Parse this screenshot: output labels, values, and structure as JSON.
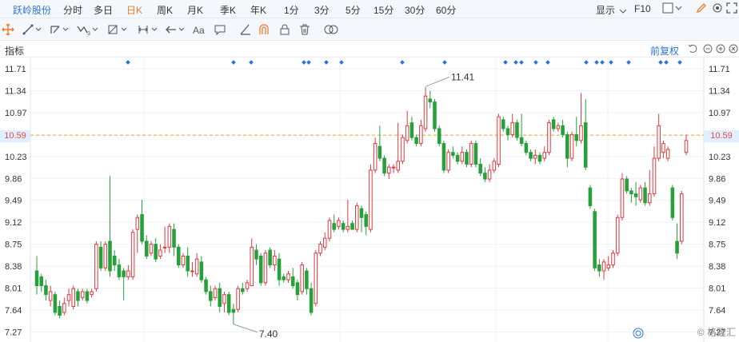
{
  "toolbar": {
    "stock_name": "跃岭股份",
    "periods": [
      "分时",
      "多日",
      "日K",
      "周K",
      "月K",
      "季K",
      "年K",
      "1分",
      "3分",
      "5分",
      "15分",
      "30分",
      "60分"
    ],
    "active_period": "日K",
    "display_label": "显示",
    "f10_label": "F10"
  },
  "drawing_tools": [
    "move-icon",
    "line-icon",
    "channel-icon",
    "wave-icon",
    "measure-icon",
    "range-icon",
    "arrow-icon",
    "text-icon",
    "comment-icon",
    "pen-icon",
    "magnet-icon",
    "lock-icon",
    "trash-icon",
    "eye-icon"
  ],
  "indicator_bar": {
    "label": "指标",
    "restore_label": "前复权"
  },
  "price_axis": {
    "ticks": [
      "11.71",
      "11.34",
      "10.97",
      "10.59",
      "10.23",
      "9.86",
      "9.49",
      "9.12",
      "8.75",
      "8.38",
      "8.01",
      "7.64",
      "7.27"
    ],
    "current_price": "10.59",
    "current_price_right": "10.59"
  },
  "annotations": {
    "high": "11.41",
    "low": "7.40"
  },
  "watermark": "格隆汇",
  "colors": {
    "up": "#e0393e",
    "down": "#26a03a",
    "accent": "#2e73d6",
    "active": "#f0792b",
    "price_line": "#f0a030"
  },
  "chart_data": {
    "type": "candlestick",
    "ylim": [
      7.1,
      11.9
    ],
    "y_ticks": [
      11.71,
      11.34,
      10.97,
      10.59,
      10.23,
      9.86,
      9.49,
      9.12,
      8.75,
      8.38,
      8.01,
      7.64,
      7.27
    ],
    "reference_price": 10.59,
    "high_marker": 11.41,
    "low_marker": 7.4,
    "candles": [
      [
        8.3,
        8.05,
        8.55,
        7.9
      ],
      [
        8.2,
        8.05,
        8.25,
        7.95
      ],
      [
        8.05,
        7.9,
        8.15,
        7.8
      ],
      [
        7.8,
        7.95,
        8.05,
        7.7
      ],
      [
        7.9,
        7.6,
        7.95,
        7.55
      ],
      [
        7.7,
        7.55,
        7.8,
        7.5
      ],
      [
        7.6,
        7.75,
        7.85,
        7.55
      ],
      [
        7.8,
        7.9,
        8.0,
        7.7
      ],
      [
        7.7,
        8.0,
        8.05,
        7.65
      ],
      [
        7.95,
        7.8,
        8.0,
        7.7
      ],
      [
        7.85,
        7.95,
        8.0,
        7.8
      ],
      [
        7.95,
        7.8,
        8.0,
        7.75
      ],
      [
        7.9,
        7.95,
        8.0,
        7.85
      ],
      [
        8.0,
        8.75,
        8.8,
        7.95
      ],
      [
        8.7,
        8.35,
        8.8,
        8.3
      ],
      [
        8.35,
        8.75,
        8.8,
        8.3
      ],
      [
        8.8,
        8.3,
        9.9,
        8.2
      ],
      [
        8.55,
        8.4,
        8.65,
        8.3
      ],
      [
        8.4,
        8.2,
        8.5,
        8.15
      ],
      [
        8.3,
        8.2,
        8.35,
        7.8
      ],
      [
        8.2,
        8.3,
        8.4,
        8.15
      ],
      [
        8.2,
        8.95,
        9.0,
        8.15
      ],
      [
        9.0,
        9.2,
        9.25,
        8.6
      ],
      [
        9.25,
        8.8,
        9.5,
        8.75
      ],
      [
        8.8,
        8.55,
        8.9,
        8.5
      ],
      [
        8.6,
        8.75,
        8.8,
        8.55
      ],
      [
        8.75,
        8.5,
        8.85,
        8.45
      ],
      [
        8.55,
        8.65,
        8.75,
        8.5
      ],
      [
        8.7,
        8.7,
        9.05,
        8.6
      ],
      [
        8.7,
        9.05,
        9.1,
        8.6
      ],
      [
        9.0,
        8.7,
        9.1,
        8.55
      ],
      [
        8.7,
        8.4,
        8.75,
        8.35
      ],
      [
        8.4,
        8.55,
        8.6,
        8.35
      ],
      [
        8.55,
        8.3,
        8.7,
        8.2
      ],
      [
        8.3,
        8.3,
        8.45,
        8.2
      ],
      [
        8.25,
        8.5,
        8.6,
        8.2
      ],
      [
        8.45,
        8.15,
        8.55,
        8.1
      ],
      [
        8.15,
        7.95,
        8.2,
        7.9
      ],
      [
        7.95,
        7.8,
        8.05,
        7.7
      ],
      [
        7.85,
        8.0,
        8.05,
        7.8
      ],
      [
        8.0,
        7.7,
        8.1,
        7.6
      ],
      [
        7.75,
        7.9,
        7.95,
        7.6
      ],
      [
        7.9,
        7.6,
        7.95,
        7.55
      ],
      [
        7.65,
        7.6,
        7.75,
        7.4
      ],
      [
        7.65,
        8.0,
        8.05,
        7.6
      ],
      [
        8.0,
        7.95,
        8.1,
        7.9
      ],
      [
        8.0,
        8.1,
        8.15,
        7.95
      ],
      [
        8.05,
        8.7,
        8.85,
        8.05
      ],
      [
        8.65,
        8.5,
        8.75,
        8.4
      ],
      [
        8.55,
        8.1,
        8.6,
        8.05
      ],
      [
        8.1,
        8.6,
        8.65,
        8.05
      ],
      [
        8.65,
        8.4,
        8.7,
        8.35
      ],
      [
        8.4,
        8.55,
        8.65,
        8.3
      ],
      [
        8.5,
        8.15,
        8.6,
        8.05
      ],
      [
        8.2,
        8.15,
        8.25,
        8.1
      ],
      [
        8.15,
        8.25,
        8.3,
        8.1
      ],
      [
        8.2,
        8.05,
        8.35,
        8.0
      ],
      [
        8.1,
        7.9,
        8.15,
        7.8
      ],
      [
        7.95,
        8.4,
        8.45,
        7.9
      ],
      [
        8.3,
        8.0,
        8.35,
        7.9
      ],
      [
        8.0,
        7.6,
        8.1,
        7.55
      ],
      [
        7.75,
        8.6,
        8.65,
        7.7
      ],
      [
        8.6,
        8.75,
        8.8,
        8.55
      ],
      [
        8.7,
        8.85,
        8.95,
        8.65
      ],
      [
        8.85,
        9.15,
        9.2,
        8.8
      ],
      [
        9.1,
        9.0,
        9.25,
        8.95
      ],
      [
        9.05,
        9.15,
        9.2,
        9.0
      ],
      [
        9.1,
        9.0,
        9.15,
        8.95
      ],
      [
        9.0,
        9.05,
        9.5,
        8.95
      ],
      [
        9.1,
        9.0,
        9.15,
        9.0
      ],
      [
        9.0,
        9.4,
        9.45,
        8.95
      ],
      [
        9.35,
        9.2,
        9.4,
        8.95
      ],
      [
        9.25,
        9.05,
        9.3,
        8.9
      ],
      [
        9.0,
        10.0,
        10.1,
        8.95
      ],
      [
        10.0,
        10.45,
        10.55,
        9.95
      ],
      [
        10.4,
        10.2,
        10.75,
        10.15
      ],
      [
        10.2,
        9.95,
        10.25,
        9.9
      ],
      [
        9.95,
        10.05,
        10.1,
        9.85
      ],
      [
        10.05,
        10.05,
        10.1,
        9.95
      ],
      [
        10.0,
        10.15,
        10.8,
        9.95
      ],
      [
        10.15,
        10.55,
        10.6,
        10.1
      ],
      [
        10.5,
        10.75,
        11.0,
        10.45
      ],
      [
        10.8,
        10.55,
        10.9,
        10.5
      ],
      [
        10.55,
        10.45,
        10.6,
        10.4
      ],
      [
        10.45,
        10.75,
        10.85,
        10.4
      ],
      [
        10.7,
        11.25,
        11.4,
        10.65
      ],
      [
        11.2,
        11.15,
        11.34,
        11.05
      ],
      [
        11.15,
        10.7,
        11.2,
        10.65
      ],
      [
        10.7,
        10.45,
        10.75,
        10.4
      ],
      [
        10.45,
        10.0,
        10.5,
        9.95
      ],
      [
        10.0,
        10.3,
        10.35,
        9.95
      ],
      [
        10.3,
        10.25,
        10.4,
        10.2
      ],
      [
        10.25,
        10.15,
        10.3,
        10.1
      ],
      [
        10.15,
        10.3,
        10.4,
        10.1
      ],
      [
        10.3,
        10.1,
        10.35,
        10.05
      ],
      [
        10.1,
        10.45,
        10.5,
        10.05
      ],
      [
        10.45,
        10.1,
        10.5,
        10.05
      ],
      [
        10.1,
        9.95,
        10.2,
        9.9
      ],
      [
        9.95,
        9.85,
        10.05,
        9.8
      ],
      [
        9.85,
        10.0,
        10.1,
        9.8
      ],
      [
        10.0,
        10.15,
        10.2,
        9.95
      ],
      [
        10.1,
        10.9,
        10.95,
        10.05
      ],
      [
        10.85,
        10.7,
        10.9,
        10.65
      ],
      [
        10.7,
        10.6,
        10.75,
        10.5
      ],
      [
        10.6,
        10.8,
        10.95,
        10.55
      ],
      [
        10.8,
        10.55,
        10.85,
        10.5
      ],
      [
        10.55,
        10.45,
        10.95,
        10.4
      ],
      [
        10.45,
        10.3,
        10.5,
        10.25
      ],
      [
        10.3,
        10.2,
        10.35,
        10.15
      ],
      [
        10.2,
        10.25,
        10.35,
        10.1
      ],
      [
        10.25,
        10.15,
        10.3,
        10.1
      ],
      [
        10.2,
        10.3,
        10.4,
        10.15
      ],
      [
        10.3,
        10.8,
        10.85,
        10.25
      ],
      [
        10.85,
        10.7,
        10.9,
        10.65
      ],
      [
        10.7,
        10.75,
        10.8,
        10.65
      ],
      [
        10.75,
        10.6,
        10.85,
        10.55
      ],
      [
        10.6,
        10.2,
        10.65,
        10.05
      ],
      [
        10.2,
        10.6,
        10.65,
        10.15
      ],
      [
        10.6,
        10.5,
        10.9,
        10.4
      ],
      [
        10.5,
        10.75,
        11.3,
        10.45
      ],
      [
        10.8,
        10.05,
        11.2,
        10.0
      ],
      [
        9.7,
        9.4,
        9.75,
        9.35
      ],
      [
        9.3,
        8.35,
        9.35,
        8.3
      ],
      [
        8.4,
        8.3,
        8.5,
        8.2
      ],
      [
        8.3,
        8.45,
        8.5,
        8.15
      ],
      [
        8.35,
        8.4,
        8.55,
        8.3
      ],
      [
        8.4,
        8.6,
        8.65,
        8.35
      ],
      [
        8.6,
        9.2,
        9.25,
        8.55
      ],
      [
        9.2,
        9.85,
        9.95,
        9.15
      ],
      [
        9.85,
        9.65,
        9.9,
        9.6
      ],
      [
        9.65,
        9.6,
        9.7,
        9.45
      ],
      [
        9.6,
        9.55,
        9.8,
        9.4
      ],
      [
        9.5,
        9.7,
        9.75,
        9.45
      ],
      [
        9.7,
        9.45,
        9.8,
        9.4
      ],
      [
        9.45,
        9.6,
        10.0,
        9.4
      ],
      [
        9.6,
        10.2,
        10.4,
        9.55
      ],
      [
        10.2,
        10.75,
        10.95,
        10.15
      ],
      [
        10.3,
        10.45,
        10.5,
        10.2
      ],
      [
        10.2,
        10.35,
        10.4,
        10.15
      ],
      [
        9.7,
        9.2,
        9.75,
        9.15
      ],
      [
        8.8,
        8.6,
        9.1,
        8.5
      ],
      [
        8.8,
        9.6,
        9.65,
        8.75
      ],
      [
        10.3,
        10.5,
        10.6,
        10.25
      ]
    ]
  }
}
